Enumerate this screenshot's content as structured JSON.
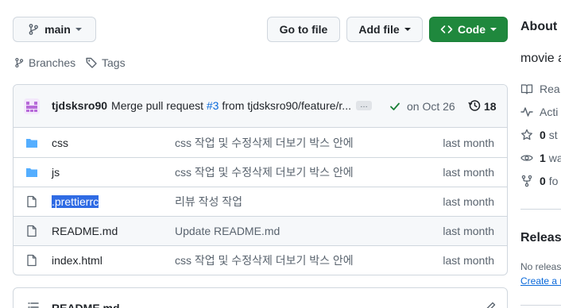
{
  "branch": {
    "name": "main"
  },
  "toolbar": {
    "go_to_file": "Go to file",
    "add_file": "Add file",
    "code": "Code"
  },
  "refs": {
    "branches": "Branches",
    "tags": "Tags"
  },
  "commit": {
    "author": "tjdsksro90",
    "message_pre": "Merge pull request ",
    "pr_link": "#3",
    "message_post": " from tjdsksro90/feature/r...",
    "ellipsis": "…",
    "date": "on Oct 26",
    "count": "18"
  },
  "files": [
    {
      "type": "folder",
      "name": "css",
      "message": "css 작업 및 수정삭제 더보기 박스 안에",
      "date": "last month"
    },
    {
      "type": "folder",
      "name": "js",
      "message": "css 작업 및 수정삭제 더보기 박스 안에",
      "date": "last month"
    },
    {
      "type": "file",
      "name": ".prettierrc",
      "message": "리뷰 작성 작업",
      "date": "last month"
    },
    {
      "type": "file",
      "name": "README.md",
      "message": "Update README.md",
      "date": "last month"
    },
    {
      "type": "file",
      "name": "index.html",
      "message": "css 작업 및 수정삭제 더보기 박스 안에",
      "date": "last month"
    }
  ],
  "readme": {
    "title": "README.md"
  },
  "sidebar": {
    "about": "About",
    "description": "movie a",
    "readme": "Rea",
    "activity": "Acti",
    "stars_num": "0",
    "stars_label": "st",
    "watch_num": "1",
    "watch_label": "wa",
    "forks_num": "0",
    "forks_label": "fo",
    "releases": "Release",
    "no_releases": "No releas",
    "create_release": "Create a n"
  },
  "colors": {
    "accent_green": "#1f883d",
    "link_blue": "#0969da",
    "folder_blue": "#54aeff",
    "selection": "#2f6be4"
  }
}
